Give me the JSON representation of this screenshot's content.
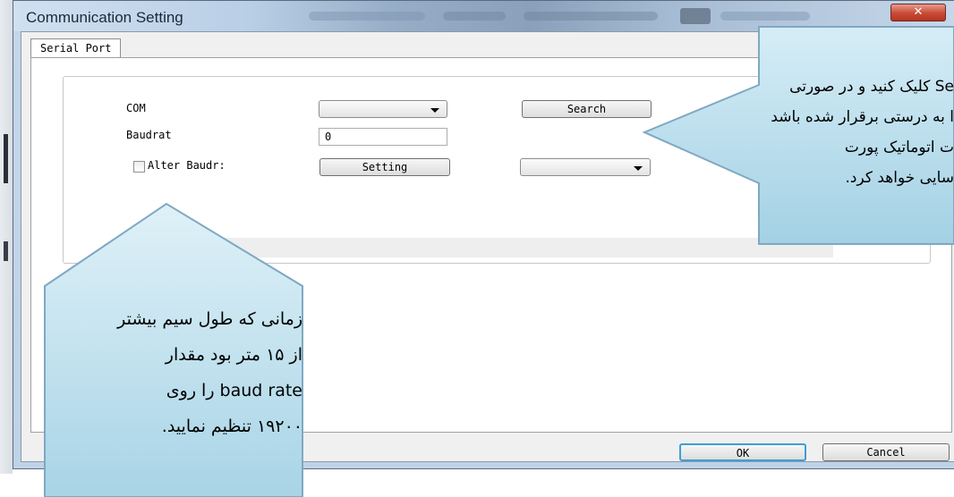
{
  "window": {
    "title": "Communication Setting",
    "close_glyph": "✕"
  },
  "tabs": [
    {
      "label": "Serial Port",
      "active": true
    }
  ],
  "form": {
    "com_label": "COM",
    "com_value": "",
    "search_label": "Search",
    "baudrate_label": "Baudrat",
    "baudrate_value": "0",
    "alter_baud_label": "Alter Baudr:",
    "alter_baud_checked": false,
    "setting_label": "Setting",
    "alter_baud_combo_value": ""
  },
  "footer": {
    "ok_label": "OK",
    "cancel_label": "Cancel"
  },
  "callouts": {
    "right": [
      "Se کلیک کنید و در صورتی",
      "ا به درستی برقرار شده باشد",
      "ت اتوماتیک پورت",
      "سایی خواهد کرد."
    ],
    "left": [
      "زمانی که طول سیم بیشتر",
      "از ۱۵ متر بود مقدار",
      "baud rate را روی",
      "۱۹۲۰۰ تنظیم نمایید."
    ]
  },
  "colors": {
    "callout_fill_top": "#d4ecf5",
    "callout_fill_bottom": "#a7d4e6",
    "callout_border": "#7fa8c3",
    "ok_focus": "#3c9fd6"
  },
  "icons": {
    "close": "close-icon",
    "dropdown": "chevron-down-icon"
  }
}
